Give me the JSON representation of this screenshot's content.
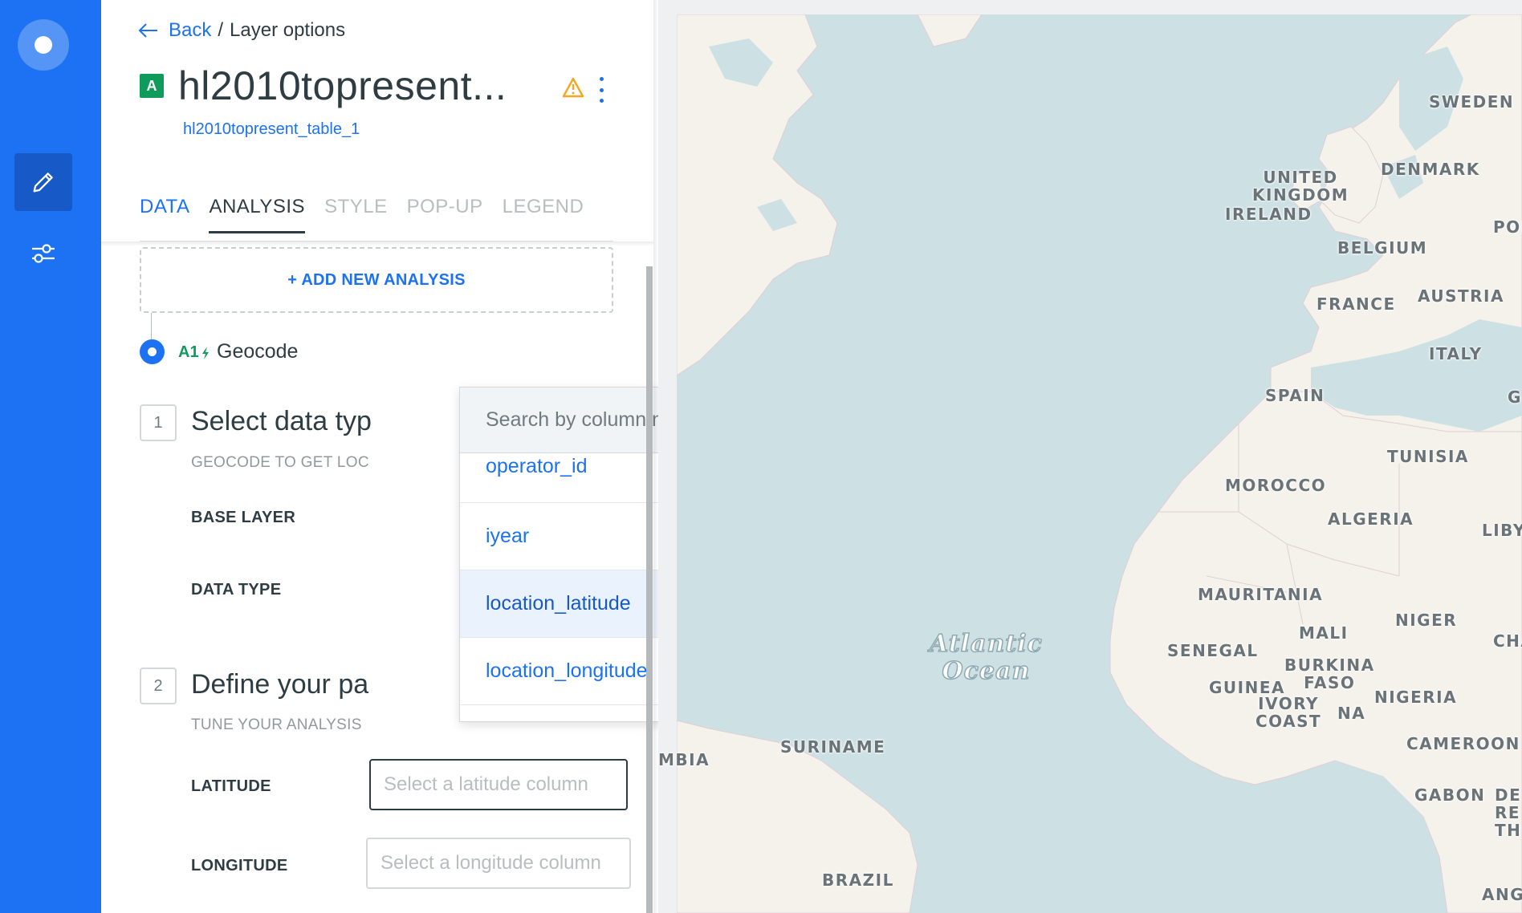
{
  "breadcrumb": {
    "back_label": "Back",
    "separator": "/",
    "current": "Layer options"
  },
  "layer": {
    "badge": "A",
    "title": "hl2010topresent...",
    "subtitle": "hl2010topresent_table_1"
  },
  "tabs": [
    {
      "label": "DATA"
    },
    {
      "label": "ANALYSIS"
    },
    {
      "label": "STYLE"
    },
    {
      "label": "POP-UP"
    },
    {
      "label": "LEGEND"
    }
  ],
  "add_analysis_label": "+ ADD NEW ANALYSIS",
  "analysis": {
    "id": "A1",
    "name": "Geocode"
  },
  "step1": {
    "number": "1",
    "title": "Select data typ",
    "subtitle": "GEOCODE TO GET LOC",
    "base_layer_label": "BASE LAYER",
    "data_type_label": "DATA TYPE"
  },
  "step2": {
    "number": "2",
    "title": "Define your pa",
    "subtitle": "TUNE YOUR ANALYSIS",
    "latitude_label": "LATITUDE",
    "latitude_placeholder": "Select a latitude column",
    "longitude_label": "LONGITUDE",
    "longitude_placeholder": "Select a longitude column"
  },
  "dropdown": {
    "search_placeholder": "Search by column name",
    "items": [
      "operator_id",
      "iyear",
      "location_latitude",
      "location_longitude"
    ],
    "hovered": "location_latitude"
  },
  "map": {
    "labels": {
      "sweden": "SWEDEN",
      "denmark": "DENMARK",
      "uk": "UNITED\nKINGDOM",
      "ireland": "IRELAND",
      "pola": "POLA",
      "belgium": "BELGIUM",
      "france": "FRANCE",
      "austria": "AUSTRIA",
      "italy": "ITALY",
      "spain": "SPAIN",
      "g": "G",
      "tunisia": "TUNISIA",
      "morocco": "MOROCCO",
      "algeria": "ALGERIA",
      "liby": "LIBY",
      "mauritania": "MAURITANIA",
      "niger": "NIGER",
      "cha": "CHA",
      "mali": "MALI",
      "senegal": "SENEGAL",
      "burkina": "BURKINA\nFASO",
      "guinea": "GUINEA",
      "ivory": "IVORY\nCOAST",
      "na": "NA",
      "nigeria": "NIGERIA",
      "cameroon": "CAMEROON",
      "suriname": "SURINAME",
      "mbia": "MBIA",
      "gabon": "GABON",
      "de": "DE\nRE\nTH",
      "brazil": "BRAZIL",
      "ango": "ANGO",
      "ocean": "Atlantic\nOcean"
    }
  },
  "colors": {
    "accent": "#1c72f2",
    "rail": "#1c72f2",
    "layer_badge": "#0f9b5b",
    "warning": "#f5a623",
    "water": "#cde0e4",
    "land": "#f5f2ec"
  }
}
